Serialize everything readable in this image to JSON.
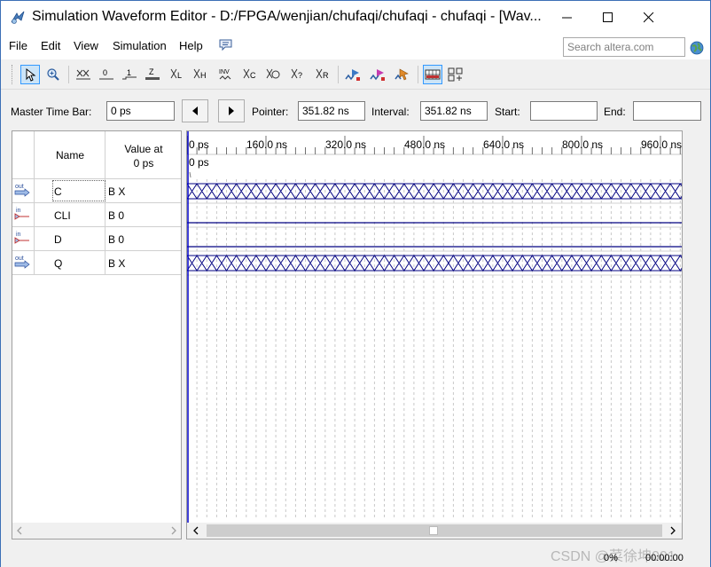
{
  "window": {
    "title": "Simulation Waveform Editor - D:/FPGA/wenjian/chufaqi/chufaqi - chufaqi - [Wav..."
  },
  "menu": {
    "file": "File",
    "edit": "Edit",
    "view": "View",
    "simulation": "Simulation",
    "help": "Help"
  },
  "search": {
    "placeholder": "Search altera.com"
  },
  "toolbar": {
    "icons": [
      "pointer-tool-icon",
      "zoom-tool-icon",
      "force-unknown-icon",
      "force-low-icon",
      "force-high-icon",
      "force-high-impedance-icon",
      "force-weak-low-icon",
      "force-weak-high-icon",
      "invert-icon",
      "count-value-icon",
      "overwrite-clock-icon",
      "random-values-icon",
      "arbitrary-value-icon",
      "run-functional-simulation-icon",
      "run-timing-simulation-icon",
      "generate-netlist-icon",
      "snap-to-grid-icon",
      "sort-icon"
    ]
  },
  "timebar": {
    "master_label": "Master Time Bar:",
    "master_value": "0 ps",
    "pointer_label": "Pointer:",
    "pointer_value": "351.82 ns",
    "interval_label": "Interval:",
    "interval_value": "351.82 ns",
    "start_label": "Start:",
    "start_value": "",
    "end_label": "End:",
    "end_value": ""
  },
  "signals": {
    "header_name": "Name",
    "header_value_line1": "Value at",
    "header_value_line2": "0 ps",
    "rows": [
      {
        "dir": "out",
        "name": "C",
        "value": "B X"
      },
      {
        "dir": "in",
        "name": "CLI",
        "value": "B 0"
      },
      {
        "dir": "in",
        "name": "D",
        "value": "B 0"
      },
      {
        "dir": "out",
        "name": "Q",
        "value": "B X"
      }
    ]
  },
  "timeline": {
    "ticks": [
      "0 ps",
      "160.0 ns",
      "320.0 ns",
      "480.0 ns",
      "640.0 ns",
      "800.0 ns",
      "960.0 ns"
    ],
    "cursor_label": "0 ps"
  },
  "status": {
    "percent": "0%",
    "elapsed": "00:00:00",
    "watermark": "CSDN @菜徐坤001"
  },
  "colors": {
    "title_bar": "#ffffff",
    "accent": "#3c6fb6",
    "wave": "#000080",
    "grid": "#c8c8c8"
  }
}
